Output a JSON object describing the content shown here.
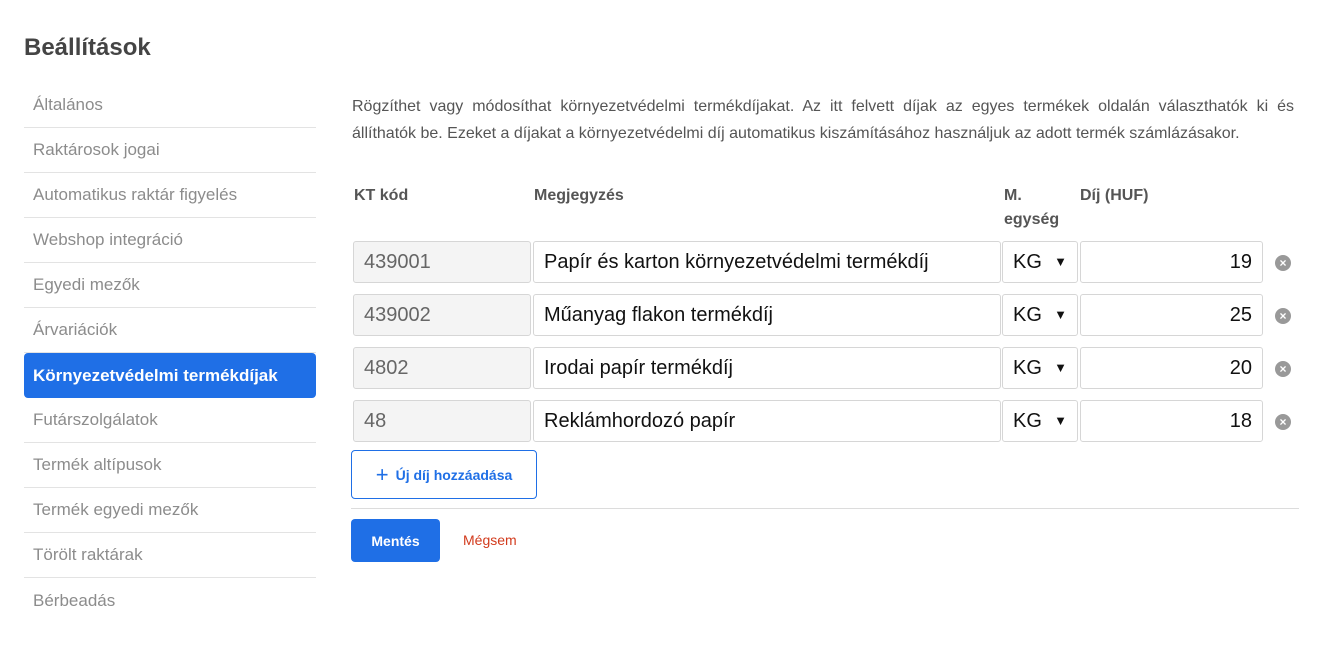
{
  "page": {
    "title": "Beállítások"
  },
  "sidebar": {
    "items": [
      {
        "label": "Általános"
      },
      {
        "label": "Raktárosok jogai"
      },
      {
        "label": "Automatikus raktár figyelés"
      },
      {
        "label": "Webshop integráció"
      },
      {
        "label": "Egyedi mezők"
      },
      {
        "label": "Árvariációk"
      },
      {
        "label": "Környezetvédelmi termékdíjak",
        "active": true
      },
      {
        "label": "Futárszolgálatok"
      },
      {
        "label": "Termék altípusok"
      },
      {
        "label": "Termék egyedi mezők"
      },
      {
        "label": "Törölt raktárak"
      },
      {
        "label": "Bérbeadás"
      }
    ]
  },
  "main": {
    "description": "Rögzíthet vagy módosíthat környezetvédelmi termékdíjakat. Az itt felvett díjak az egyes termékek oldalán választhatók ki és állíthatók be. Ezeket a díjakat a környezetvédelmi díj automatikus kiszámításához használjuk az adott termék számlázásakor.",
    "columns": {
      "code": "KT kód",
      "note": "Megjegyzés",
      "unit_line1": "M.",
      "unit_line2": "egység",
      "fee": "Díj (HUF)"
    },
    "rows": [
      {
        "code": "439001",
        "note": "Papír és karton környezetvédelmi termékdíj",
        "unit": "KG",
        "fee": "19"
      },
      {
        "code": "439002",
        "note": "Műanyag flakon termékdíj",
        "unit": "KG",
        "fee": "25"
      },
      {
        "code": "4802",
        "note": "Irodai papír termékdíj",
        "unit": "KG",
        "fee": "20"
      },
      {
        "code": "48",
        "note": "Reklámhordozó papír",
        "unit": "KG",
        "fee": "18"
      }
    ],
    "add_button": {
      "label": "Új díj hozzáadása",
      "icon": "plus-icon"
    },
    "save_label": "Mentés",
    "cancel_label": "Mégsem"
  },
  "colors": {
    "accent": "#1f6fe6",
    "cancel": "#d23a1c"
  }
}
